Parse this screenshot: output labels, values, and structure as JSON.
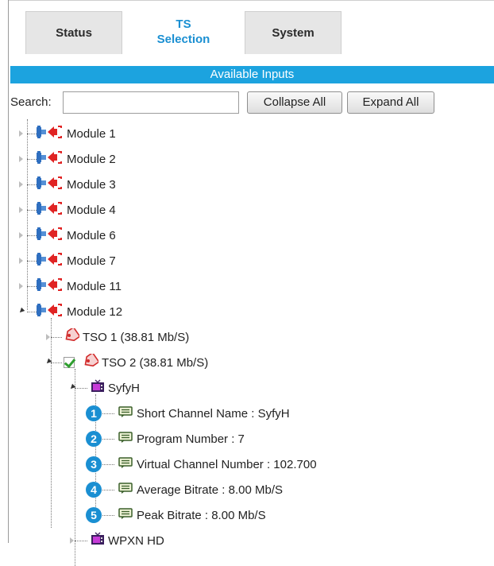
{
  "tabs": [
    {
      "line1": "Status",
      "line2": "",
      "active": false
    },
    {
      "line1": "TS",
      "line2": "Selection",
      "active": true
    },
    {
      "line1": "System",
      "line2": "",
      "active": false
    }
  ],
  "header": {
    "title": "Available Inputs"
  },
  "search": {
    "label": "Search:",
    "value": "",
    "placeholder": ""
  },
  "buttons": {
    "collapse": "Collapse All",
    "expand": "Expand All"
  },
  "modules": [
    "Module 1",
    "Module 2",
    "Module 3",
    "Module 4",
    "Module 6",
    "Module 7",
    "Module 11",
    "Module 12"
  ],
  "tso": [
    "TSO 1 (38.81 Mb/S)",
    "TSO 2 (38.81 Mb/S)"
  ],
  "tso2_checked": true,
  "channels": [
    "SyfyH",
    "WPXN HD"
  ],
  "properties": [
    {
      "badge": "1",
      "text": "Short Channel Name : SyfyH"
    },
    {
      "badge": "2",
      "text": "Program Number : 7"
    },
    {
      "badge": "3",
      "text": "Virtual Channel Number : 102.700"
    },
    {
      "badge": "4",
      "text": "Average Bitrate : 8.00 Mb/S"
    },
    {
      "badge": "5",
      "text": "Peak Bitrate : 8.00 Mb/S"
    }
  ],
  "colors": {
    "accent": "#1ca3df",
    "badge": "#1a8fd2",
    "active_tab_text": "#1a8fd2"
  },
  "icons": {
    "module": "connector-icon",
    "tso": "tag-icon",
    "channel": "tv-icon",
    "property": "comment-icon"
  }
}
